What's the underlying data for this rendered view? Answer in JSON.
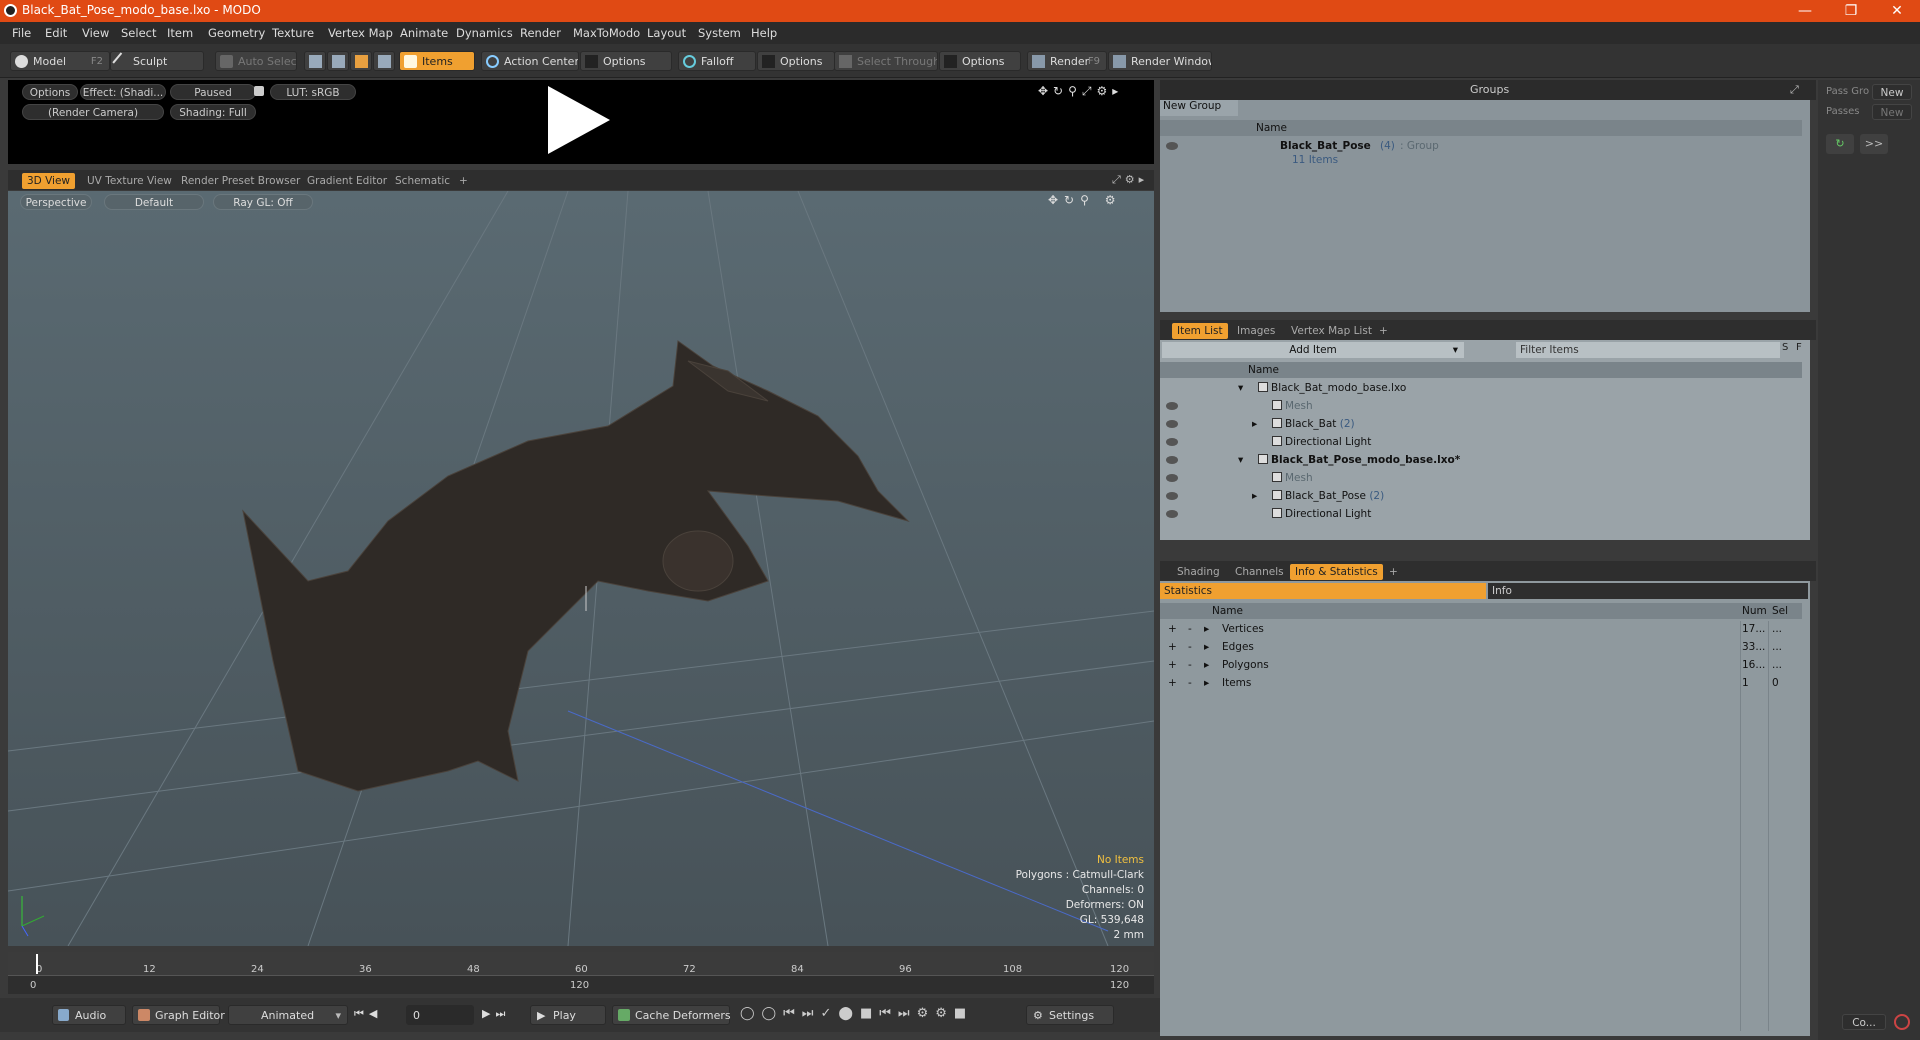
{
  "window": {
    "title": "Black_Bat_Pose_modo_base.lxo - MODO"
  },
  "menu": [
    "File",
    "Edit",
    "View",
    "Select",
    "Item",
    "Geometry",
    "Texture",
    "Vertex Map",
    "Animate",
    "Dynamics",
    "Render",
    "MaxToModo",
    "Layout",
    "System",
    "Help"
  ],
  "toolbar": {
    "model": "Model",
    "model_key": "F2",
    "sculpt": "Sculpt",
    "auto_select": "Auto Select",
    "items": "Items",
    "action_center": "Action Center",
    "options1": "Options",
    "falloff": "Falloff",
    "options2": "Options",
    "select_through": "Select Through",
    "options3": "Options",
    "render": "Render",
    "render_key": "F9",
    "render_window": "Render Window"
  },
  "preview": {
    "options": "Options",
    "effect": "Effect: (Shadi...",
    "paused": "Paused",
    "lut": "LUT: sRGB",
    "camera": "(Render Camera)",
    "shading": "Shading: Full"
  },
  "view_tabs": [
    "3D View",
    "UV Texture View",
    "Render Preset Browser",
    "Gradient Editor",
    "Schematic",
    "+"
  ],
  "viewport": {
    "projection": "Perspective",
    "style": "Default",
    "raygl": "Ray GL: Off",
    "stats": [
      "No Items",
      "Polygons : Catmull-Clark",
      "Channels: 0",
      "Deformers: ON",
      "GL: 539,648",
      "2 mm"
    ]
  },
  "timeline": {
    "ticks": [
      "0",
      "12",
      "24",
      "36",
      "48",
      "60",
      "72",
      "84",
      "96",
      "108",
      "120"
    ],
    "range_start": "0",
    "range_mid": "120",
    "range_end": "120"
  },
  "bottombar": {
    "audio": "Audio",
    "graph_editor": "Graph Editor",
    "animated": "Animated",
    "frame": "0",
    "play": "Play",
    "cache": "Cache Deformers",
    "settings": "Settings"
  },
  "groups": {
    "title": "Groups",
    "new_group": "New Group",
    "col_name": "Name",
    "item_name": "Black_Bat_Pose",
    "item_count": "(4)",
    "item_type": ": Group",
    "item_sub": "11 Items"
  },
  "passes": {
    "pass_label": "Pass Gro",
    "new1": "New",
    "passes_label": "Passes",
    "new2": "New",
    "more": ">>"
  },
  "item_list": {
    "tabs": [
      "Item List",
      "Images",
      "Vertex Map List",
      "+"
    ],
    "add_item": "Add Item",
    "filter": "Filter Items",
    "s": "S",
    "f": "F",
    "col_name": "Name",
    "rows": [
      {
        "label": "Black_Bat_modo_base.lxo",
        "extra": "",
        "indent": 0,
        "bold": false
      },
      {
        "label": "Mesh",
        "extra": "",
        "indent": 1,
        "bold": false,
        "gray": true
      },
      {
        "label": "Black_Bat",
        "extra": "(2)",
        "indent": 1,
        "bold": false
      },
      {
        "label": "Directional Light",
        "extra": "",
        "indent": 1,
        "bold": false
      },
      {
        "label": "Black_Bat_Pose_modo_base.lxo*",
        "extra": "",
        "indent": 0,
        "bold": true
      },
      {
        "label": "Mesh",
        "extra": "",
        "indent": 1,
        "bold": false,
        "gray": true
      },
      {
        "label": "Black_Bat_Pose",
        "extra": "(2)",
        "indent": 1,
        "bold": false
      },
      {
        "label": "Directional Light",
        "extra": "",
        "indent": 1,
        "bold": false
      }
    ]
  },
  "stats_panel": {
    "tabs": [
      "Shading",
      "Channels",
      "Info & Statistics",
      "+"
    ],
    "statistics": "Statistics",
    "info": "Info",
    "col_name": "Name",
    "col_num": "Num",
    "col_sel": "Sel",
    "rows": [
      {
        "name": "Vertices",
        "num": "17...",
        "sel": "..."
      },
      {
        "name": "Edges",
        "num": "33...",
        "sel": "..."
      },
      {
        "name": "Polygons",
        "num": "16...",
        "sel": "..."
      },
      {
        "name": "Items",
        "num": "1",
        "sel": "0"
      }
    ]
  },
  "farright": {
    "co": "Co..."
  }
}
